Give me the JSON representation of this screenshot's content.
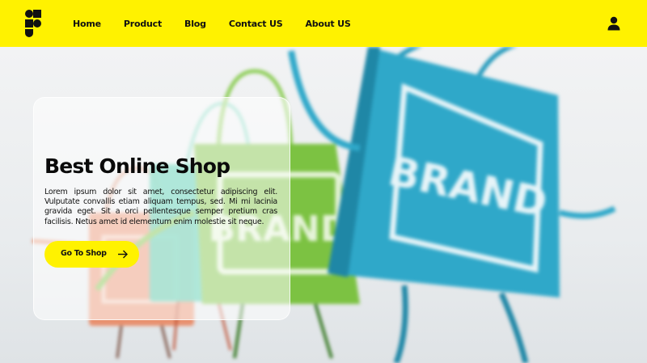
{
  "header": {
    "logo_icon": "brand-logo-icon",
    "nav": [
      {
        "label": "Home"
      },
      {
        "label": "Product"
      },
      {
        "label": "Blog"
      },
      {
        "label": "Contact US"
      },
      {
        "label": "About US"
      }
    ],
    "user_icon": "user-icon"
  },
  "hero": {
    "title": "Best Online Shop",
    "description": "Lorem ipsum dolor sit amet, consectetur adipiscing elit. Vulputate convallis etiam aliquam tempus, sed. Mi mi lacinia gravida eget. Sit a orci pellentesque semper pretium cras facilisis. Netus amet id elementum enim molestie sit neque.",
    "cta_label": "Go To Shop",
    "cta_icon": "arrow-right-icon",
    "bag_text": "BRAND"
  },
  "colors": {
    "accent": "#fff200",
    "text": "#111111",
    "bag_blue": "#2fa8c9",
    "bag_green": "#7cc242",
    "bag_teal": "#3fc7a6",
    "bag_orange": "#e9825a"
  }
}
